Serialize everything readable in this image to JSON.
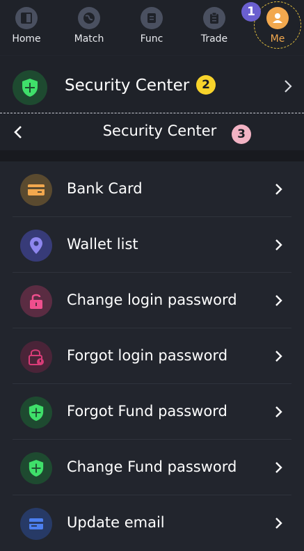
{
  "tabs": [
    {
      "label": "Home",
      "icon": "home-icon"
    },
    {
      "label": "Match",
      "icon": "globe-icon"
    },
    {
      "label": "Func",
      "icon": "document-icon"
    },
    {
      "label": "Trade",
      "icon": "clipboard-icon"
    },
    {
      "label": "Me",
      "icon": "user-icon",
      "active": true
    }
  ],
  "annotations": {
    "one": "1",
    "two": "2",
    "three": "3"
  },
  "security_row": {
    "title": "Security Center",
    "icon": "shield-icon"
  },
  "navbar": {
    "title": "Security Center"
  },
  "menu": [
    {
      "label": "Bank Card",
      "icon": "bank-card-icon",
      "color": "#f2a84e",
      "bg": "#5a4a2f"
    },
    {
      "label": "Wallet list",
      "icon": "location-pin-icon",
      "color": "#8e86ee",
      "bg": "#373b78"
    },
    {
      "label": "Change login password",
      "icon": "unlock-icon",
      "color": "#ef4f8d",
      "bg": "#5a2c42"
    },
    {
      "label": "Forgot login password",
      "icon": "lock-question-icon",
      "color": "#d83c78",
      "bg": "#4a2438"
    },
    {
      "label": "Forgot Fund password",
      "icon": "shield-icon",
      "color": "#3fe06a",
      "bg": "#1e4a30"
    },
    {
      "label": "Change Fund password",
      "icon": "shield-icon",
      "color": "#3fe06a",
      "bg": "#1e4a30"
    },
    {
      "label": "Update email",
      "icon": "email-icon",
      "color": "#4c7ff0",
      "bg": "#273a66"
    }
  ],
  "colors": {
    "background": "#22252d",
    "accent": "#f2a84e",
    "badge_1": "#6a5fcf",
    "badge_2": "#f7d32b",
    "badge_3": "#f2b3c4"
  }
}
